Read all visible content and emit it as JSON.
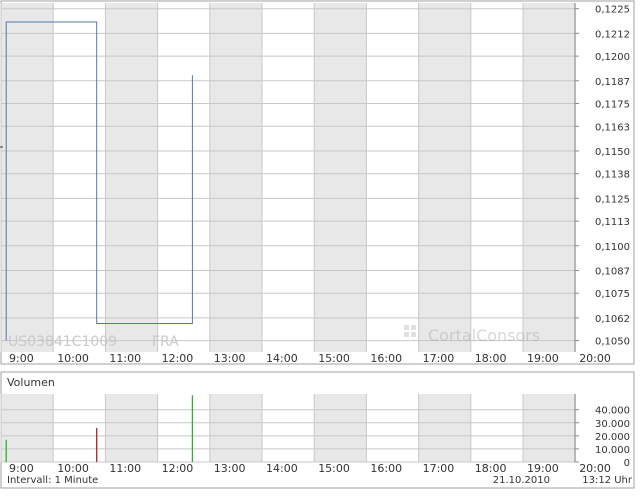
{
  "chart_data": [
    {
      "type": "line",
      "title": "",
      "instrument_id": "US03841C1009",
      "exchange": "FRA",
      "watermark": "CortalConsors",
      "x_labels": [
        "9:00",
        "10:00",
        "11:00",
        "12:00",
        "13:00",
        "14:00",
        "15:00",
        "16:00",
        "17:00",
        "18:00",
        "19:00",
        "20:00"
      ],
      "y_ticks": [
        "0,1050",
        "0,1062",
        "0,1075",
        "0,1087",
        "0,1100",
        "0,1113",
        "0,1125",
        "0,1138",
        "0,1150",
        "0,1163",
        "0,1175",
        "0,1187",
        "0,1200",
        "0,1212",
        "0,1225"
      ],
      "ylim": [
        0.1044,
        0.1228
      ],
      "grid": true,
      "series": [
        {
          "points": [
            {
              "t": "9:06",
              "v": 0.105
            },
            {
              "t": "9:06",
              "v": 0.1218
            },
            {
              "t": "10:50",
              "v": 0.1218
            },
            {
              "t": "10:50",
              "v": 0.1059
            },
            {
              "t": "12:40",
              "v": 0.1059
            },
            {
              "t": "12:40",
              "v": 0.119
            }
          ]
        }
      ]
    },
    {
      "type": "bar",
      "title": "Volumen",
      "x_labels": [
        "9:00",
        "10:00",
        "11:00",
        "12:00",
        "13:00",
        "14:00",
        "15:00",
        "16:00",
        "17:00",
        "18:00",
        "19:00",
        "20:00"
      ],
      "y_ticks": [
        "0",
        "10.000",
        "20.000",
        "30.000",
        "40.000"
      ],
      "ylim": [
        0,
        52000
      ],
      "grid": true,
      "bars": [
        {
          "t": "9:06",
          "value": 17000,
          "color": "#33aa33"
        },
        {
          "t": "10:50",
          "value": 26000,
          "color": "#aa2222"
        },
        {
          "t": "12:40",
          "value": 51000,
          "color": "#33aa33"
        }
      ]
    }
  ],
  "footer": {
    "interval": "Intervall: 1 Minute",
    "date": "21.10.2010",
    "time": "13:12 Uhr"
  },
  "colors": {
    "band": "#e8e8e8",
    "grid": "#c8c8c8",
    "line": "#5577aa",
    "frame": "#a0a0a0"
  }
}
